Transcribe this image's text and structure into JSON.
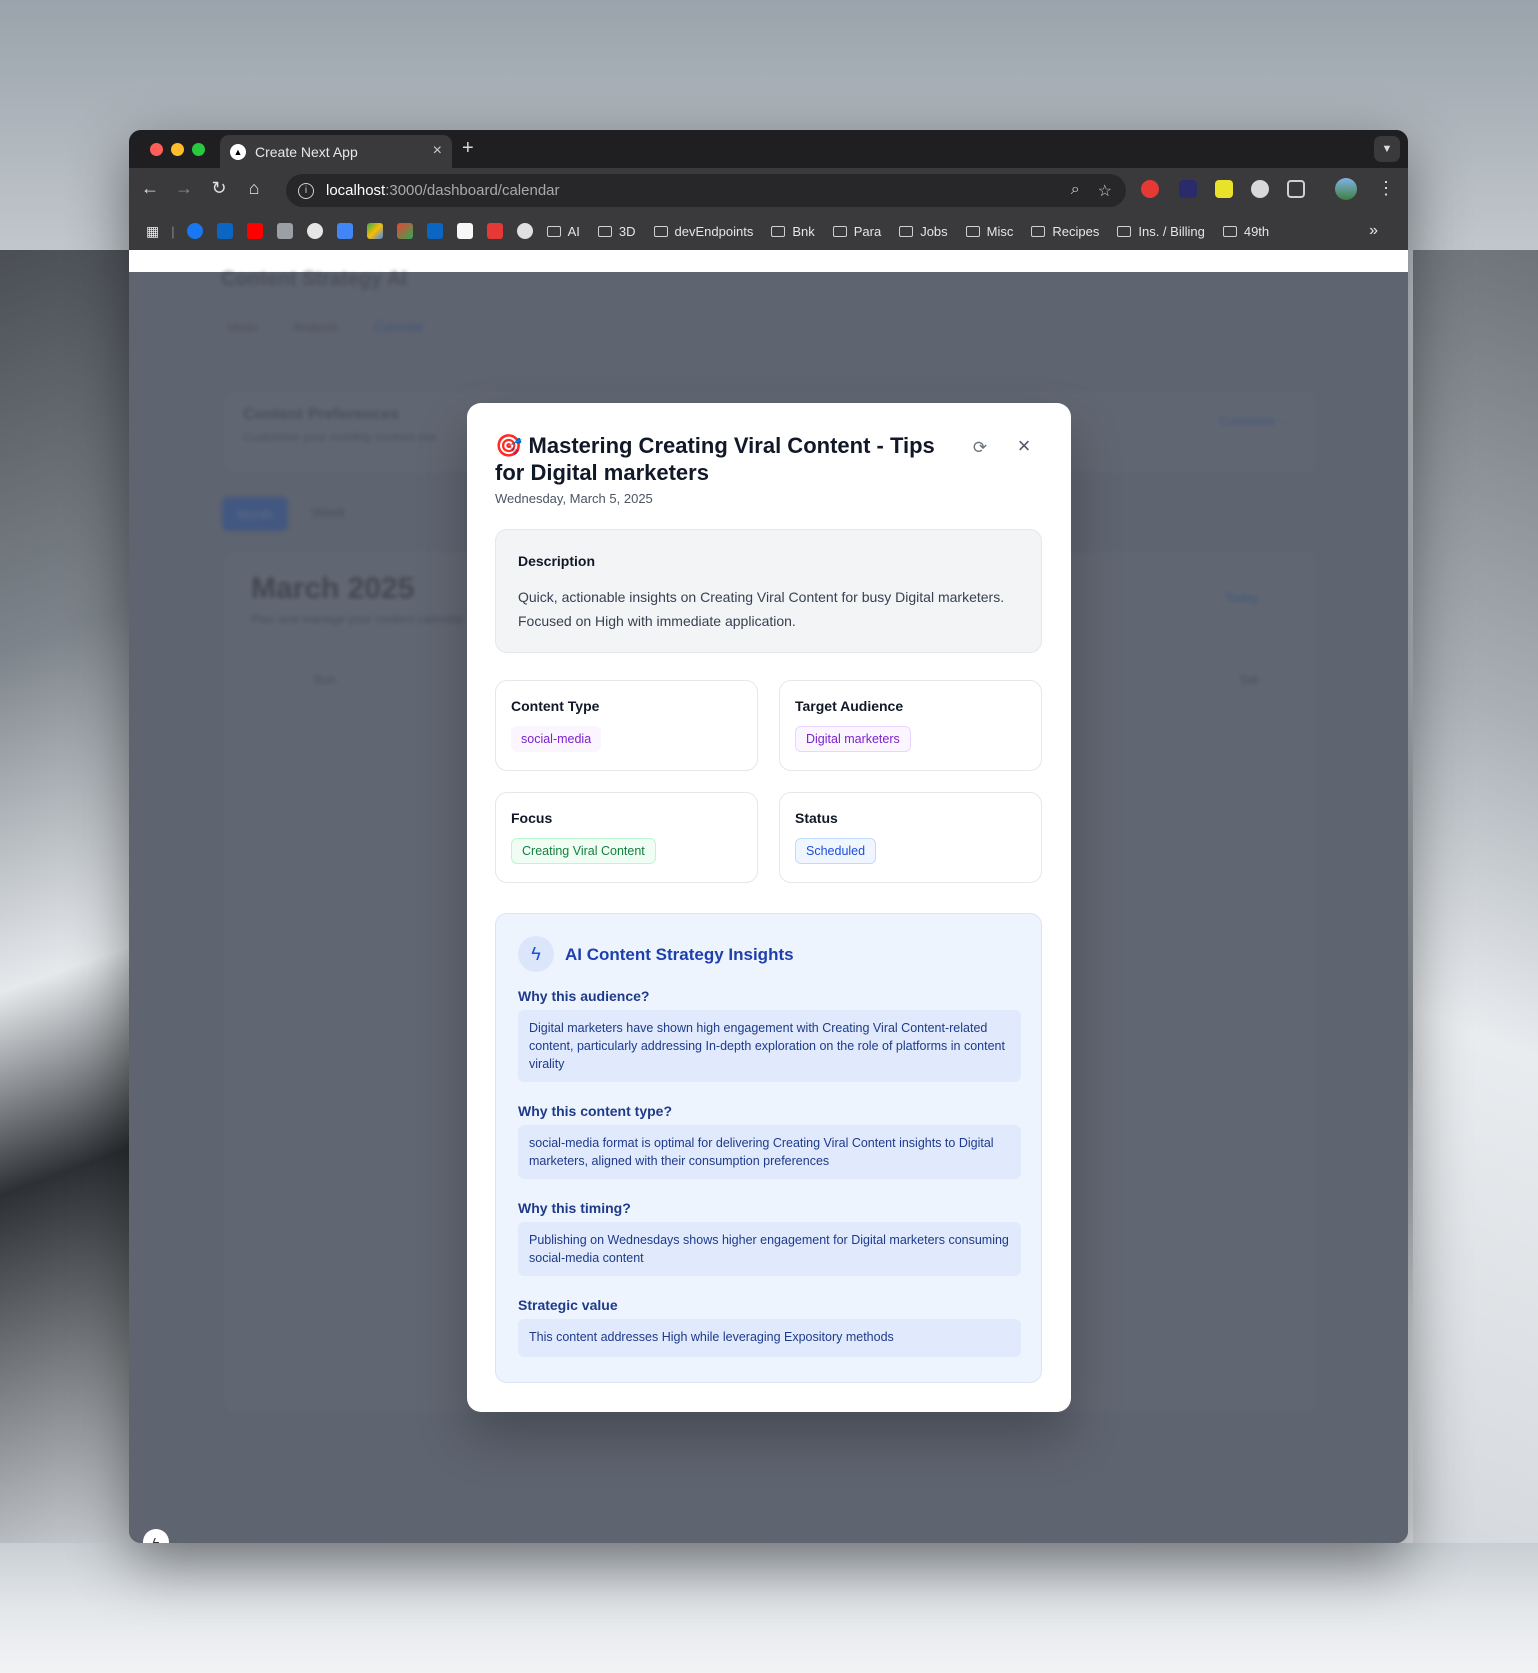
{
  "browser": {
    "tab_title": "Create Next App",
    "tab_close": "×",
    "new_tab": "+",
    "url_host": "localhost",
    "url_path": ":3000/dashboard/calendar",
    "bookmarks": [
      "AI",
      "3D",
      "devEndpoints",
      "Bnk",
      "Para",
      "Jobs",
      "Misc",
      "Recipes",
      "Ins. / Billing",
      "49th"
    ],
    "more_bookmarks": "»"
  },
  "background_page": {
    "app_title": "Content Strategy AI",
    "nav_tabs": [
      "Ideas",
      "Analysis",
      "Calendar"
    ],
    "preferences_title": "Content Preferences",
    "preferences_subtitle": "Customize your monthly content mix",
    "customize_link": "Customize →",
    "view_buttons": [
      "Month",
      "Week"
    ],
    "calendar_title": "March 2025",
    "calendar_subtitle": "Plan and manage your content calendar",
    "today_label": "Today",
    "weekday_first": "Sun",
    "weekday_last": "Sat"
  },
  "modal": {
    "emoji": "🎯",
    "title": "Mastering Creating Viral Content - Tips for Digital marketers",
    "date": "Wednesday, March 5, 2025",
    "description_heading": "Description",
    "description_text": "Quick, actionable insights on Creating Viral Content for busy Digital marketers. Focused on High with immediate application.",
    "content_type_heading": "Content Type",
    "content_type_value": "social-media",
    "audience_heading": "Target Audience",
    "audience_value": "Digital marketers",
    "focus_heading": "Focus",
    "focus_value": "Creating Viral Content",
    "status_heading": "Status",
    "status_value": "Scheduled",
    "insights_title": "AI Content Strategy Insights",
    "q1": "Why this audience?",
    "a1": "Digital marketers have shown high engagement with Creating Viral Content-related content, particularly addressing In-depth exploration on the role of platforms in content virality",
    "q2": "Why this content type?",
    "a2": "social-media format is optimal for delivering Creating Viral Content insights to Digital marketers, aligned with their consumption preferences",
    "q3": "Why this timing?",
    "a3": "Publishing on Wednesdays shows higher engagement for Digital marketers consuming social-media content",
    "q4": "Strategic value",
    "a4": "This content addresses High while leveraging Expository methods"
  },
  "colors": {
    "purple_pill_bg": "#faf5ff",
    "purple_pill_text": "#7e22ce",
    "green_pill_bg": "#f0fdf4",
    "green_pill_text": "#15803d",
    "blue_pill_bg": "#eff6ff",
    "blue_pill_text": "#1d4ed8",
    "insights_accent": "#1e40af"
  }
}
